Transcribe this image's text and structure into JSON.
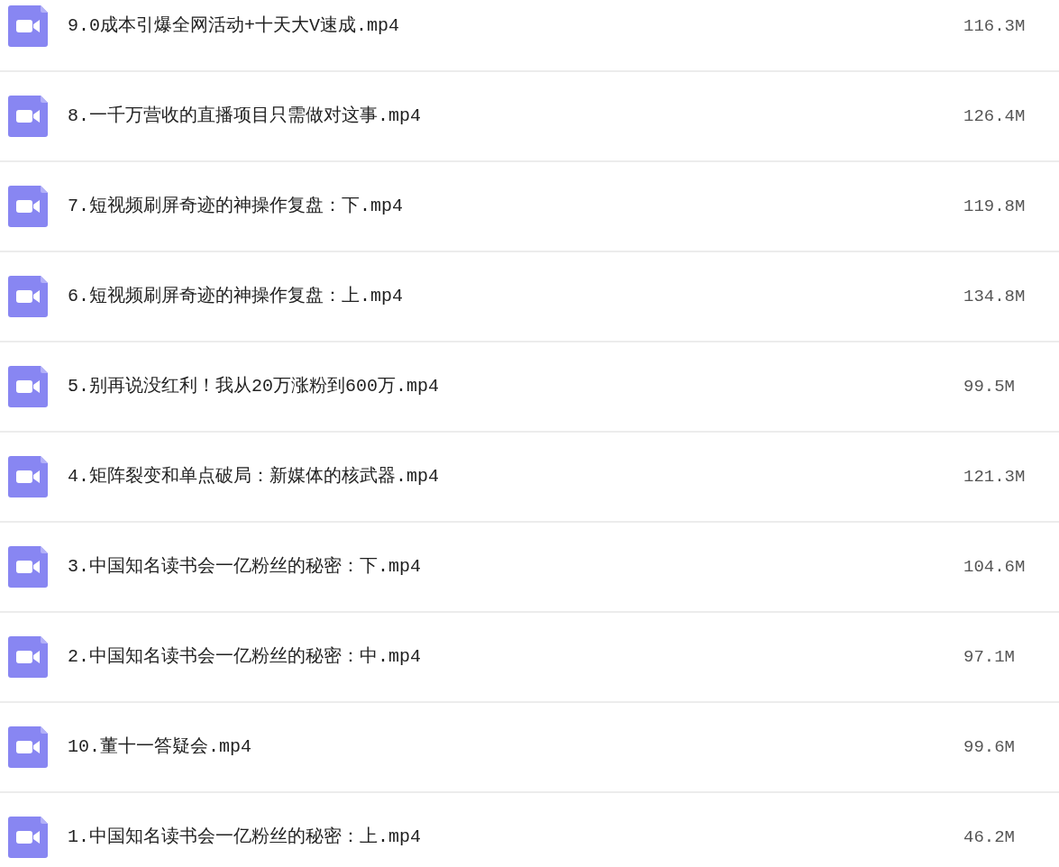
{
  "files": [
    {
      "name": "9.0成本引爆全网活动+十天大V速成.mp4",
      "size": "116.3M"
    },
    {
      "name": "8.一千万营收的直播项目只需做对这事.mp4",
      "size": "126.4M"
    },
    {
      "name": "7.短视频刷屏奇迹的神操作复盘：下.mp4",
      "size": "119.8M"
    },
    {
      "name": "6.短视频刷屏奇迹的神操作复盘：上.mp4",
      "size": "134.8M"
    },
    {
      "name": "5.别再说没红利！我从20万涨粉到600万.mp4",
      "size": "99.5M"
    },
    {
      "name": "4.矩阵裂变和单点破局：新媒体的核武器.mp4",
      "size": "121.3M"
    },
    {
      "name": "3.中国知名读书会一亿粉丝的秘密：下.mp4",
      "size": "104.6M"
    },
    {
      "name": "2.中国知名读书会一亿粉丝的秘密：中.mp4",
      "size": "97.1M"
    },
    {
      "name": "10.董十一答疑会.mp4",
      "size": "99.6M"
    },
    {
      "name": "1.中国知名读书会一亿粉丝的秘密：上.mp4",
      "size": "46.2M"
    }
  ]
}
